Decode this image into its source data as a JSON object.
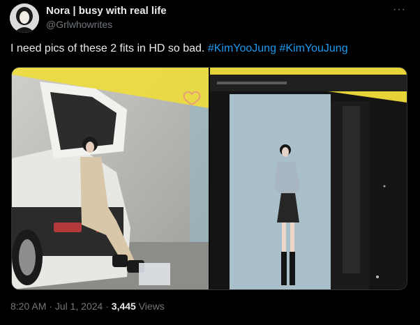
{
  "author": {
    "display_name": "Nora | busy with real life",
    "handle": "@Grlwhowrites"
  },
  "tweet": {
    "text": "I need pics of these 2 fits in HD so bad.",
    "hashtags": [
      "#KimYooJung",
      "#KimYouJung"
    ]
  },
  "meta": {
    "time": "8:20 AM",
    "dot1": "·",
    "date": "Jul 1, 2024",
    "dot2": "·",
    "views_count": "3,445",
    "views_label": "Views"
  },
  "more_label": "···",
  "colors": {
    "background": "#000000",
    "text": "#e7e9ea",
    "muted": "#71767b",
    "link": "#1d9bf0",
    "frame_yellow": "#f0dd3a"
  }
}
